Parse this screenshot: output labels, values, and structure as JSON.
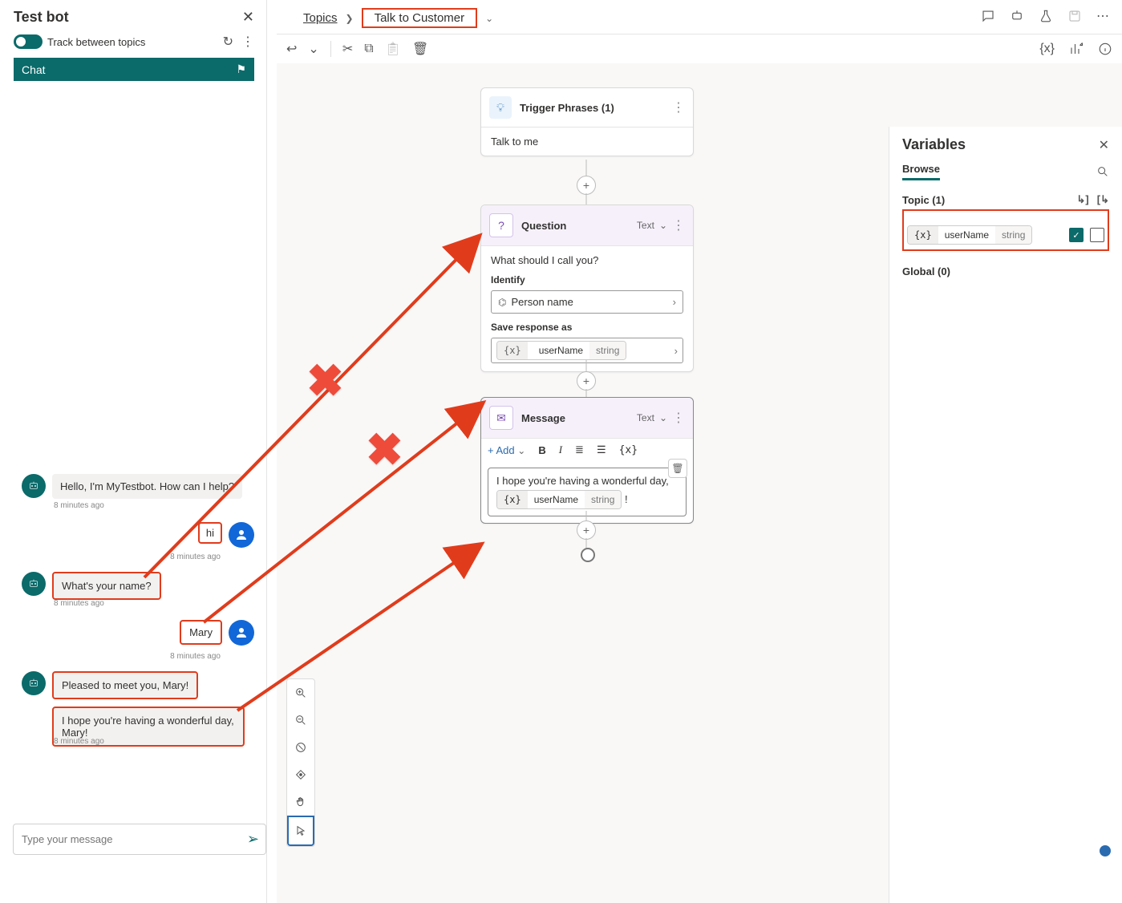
{
  "testbot": {
    "title": "Test bot",
    "track_label": "Track between topics",
    "chat_tab": "Chat",
    "input_placeholder": "Type your message",
    "messages": [
      {
        "who": "bot",
        "text": "Hello, I'm MyTestbot. How can I help?",
        "ts": "8 minutes ago"
      },
      {
        "who": "user",
        "text": "hi",
        "ts": "8 minutes ago"
      },
      {
        "who": "bot",
        "text": "What's your name?",
        "ts": "8 minutes ago"
      },
      {
        "who": "user",
        "text": "Mary",
        "ts": "8 minutes ago"
      },
      {
        "who": "bot",
        "text": "Pleased to meet you, Mary!",
        "ts": ""
      },
      {
        "who": "bot",
        "text": "I hope you're having a wonderful day, Mary!",
        "ts": "8 minutes ago"
      }
    ]
  },
  "breadcrumb": {
    "root": "Topics",
    "current": "Talk to Customer"
  },
  "toolbar": {
    "vars": "{x}"
  },
  "nodes": {
    "trigger": {
      "title": "Trigger Phrases (1)",
      "body": "Talk to me"
    },
    "question": {
      "title": "Question",
      "type": "Text",
      "prompt": "What should I call you?",
      "identify_label": "Identify",
      "identify_value": "Person name",
      "save_label": "Save response as",
      "var_name": "userName",
      "var_type": "string"
    },
    "message": {
      "title": "Message",
      "type": "Text",
      "add_label": "+  Add",
      "text": "I hope you're having a wonderful day,",
      "var_name": "userName",
      "var_type": "string",
      "tail": "!"
    }
  },
  "variables": {
    "title": "Variables",
    "browse": "Browse",
    "topic_label": "Topic (1)",
    "item": {
      "name": "userName",
      "type": "string"
    },
    "global_label": "Global (0)"
  }
}
